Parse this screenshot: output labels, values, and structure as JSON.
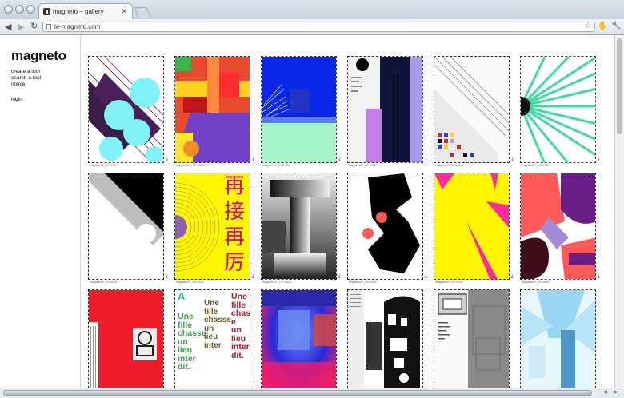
{
  "browser": {
    "tab_title": "magneto – gallery",
    "tab_close": "✕",
    "url": "le-magneto.com",
    "back": "◀",
    "forward": "▶",
    "reload": "↻",
    "star": "☆"
  },
  "sidebar": {
    "logo": "magneto",
    "links": [
      "create a tool",
      "search a tool",
      "notice"
    ],
    "login": "login"
  },
  "gallery": {
    "captions": [
      "magnetoVP_SP-0020",
      "magnetoVP_TTP-0020",
      "magnetoVP_SP-0026",
      "magnetoVP_SP-0020",
      "magnetoVP_SP-0026",
      "magnetoVP_SP-0026",
      "magnetoVP_SP-0076",
      "magnetoVP_SP-0026",
      "magnetoVP_TTP-0020",
      "magnetoVP_SP-0026",
      "magnetoVP_SP-0026",
      "magnetoVP_SP-0026"
    ],
    "poster_mandarin": [
      "再",
      "接",
      "再",
      "厉"
    ],
    "poster_french_a": "A",
    "poster_french_lines_left": [
      "Une",
      "fille",
      "chasse",
      "un",
      "lieu",
      "inter",
      "dit."
    ],
    "poster_french_lines_right": [
      "Une",
      "fille",
      "chass",
      "e",
      "un",
      "lieu",
      "inter",
      "dit."
    ]
  },
  "colors": {
    "accent_pink": "#e6007e",
    "cyan": "#7ff2f5",
    "purple": "#5c1a5c",
    "blue": "#0020e0",
    "mint": "#9ef5c8",
    "yellow": "#fff200",
    "red": "#e81c24"
  }
}
